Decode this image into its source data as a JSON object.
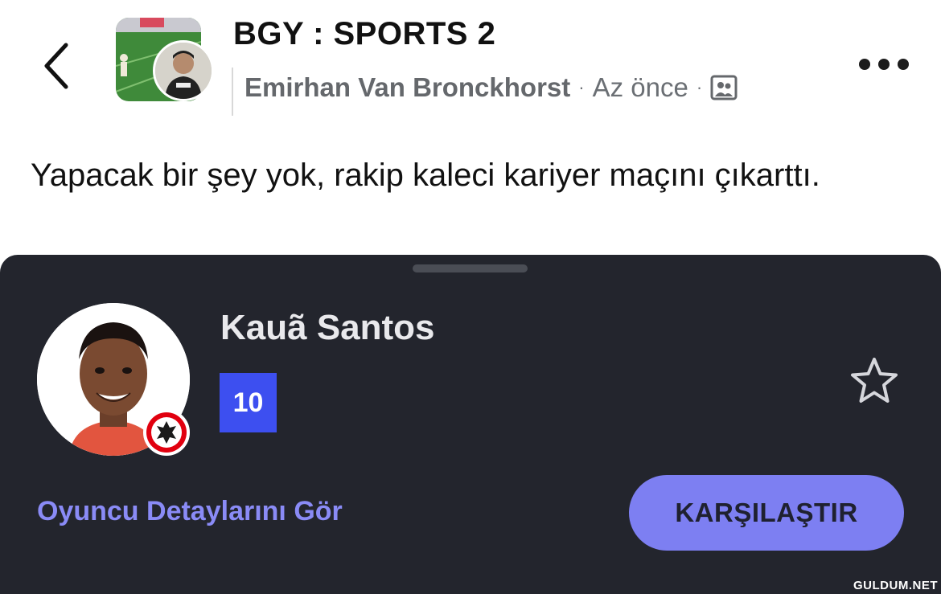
{
  "post": {
    "group_name": "BGY : SPORTS 2",
    "author": "Emirhan Van Bronckhorst",
    "separator": "·",
    "time": "Az önce",
    "audience_icon": "members-icon",
    "text": "Yapacak bir şey yok, rakip kaleci kariyer maçını çıkarttı."
  },
  "player_card": {
    "name": "Kauã Santos",
    "number": "10",
    "number_badge_color": "#3d4ff0",
    "details_link": "Oyuncu Detaylarını Gör",
    "compare_button": "KARŞILAŞTIR",
    "accent_color": "#7d7ff2",
    "favorite_icon": "star-outline-icon"
  },
  "watermark": "GULDUM.NET"
}
